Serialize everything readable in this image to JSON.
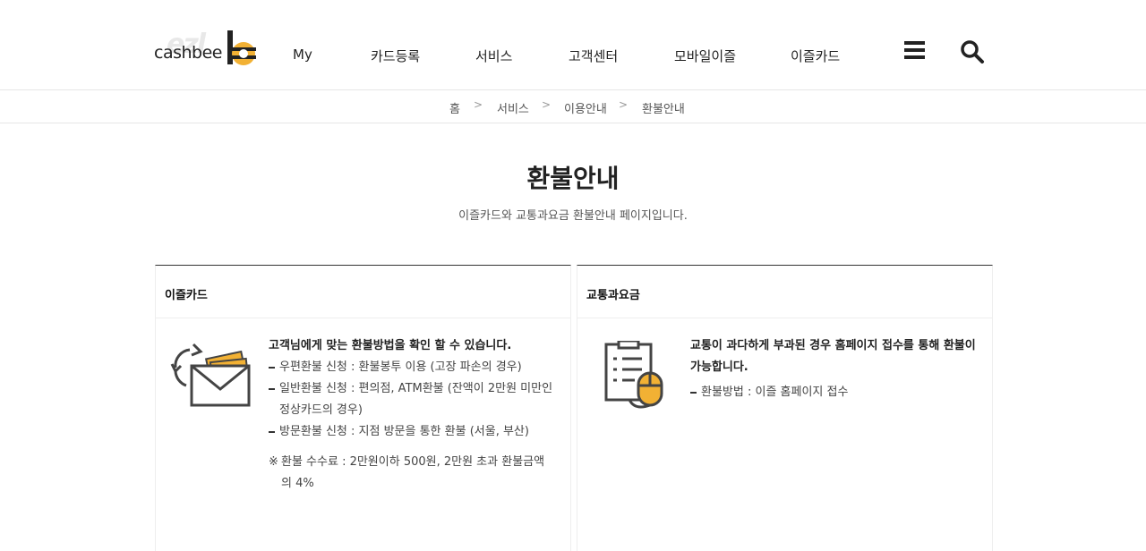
{
  "brand": {
    "logo_text": "cashbee",
    "colors": {
      "accent": "#f2b134",
      "dark": "#333333"
    }
  },
  "nav": {
    "items": [
      "My",
      "카드등록",
      "서비스",
      "고객센터",
      "모바일이즐",
      "이즐카드"
    ],
    "menu_icon": "hamburger-icon",
    "search_icon": "search-icon"
  },
  "breadcrumb": {
    "items": [
      "홈",
      "서비스",
      "이용안내",
      "환불안내"
    ],
    "separator": ">"
  },
  "page": {
    "title": "환불안내",
    "subtitle": "이즐카드와 교통과요금 환불안내 페이지입니다."
  },
  "panels": {
    "card": {
      "heading": "이즐카드",
      "lead": "고객님에게 맞는 환불방법을 확인 할 수 있습니다.",
      "items": [
        "우편환불 신청 : 환불봉투 이용 (고장 파손의 경우)",
        "일반환불 신청 : 편의점, ATM환불 (잔액이 2만원 미만인 정상카드의 경우)",
        "방문환불 신청 : 지점 방문을 통한 환불 (서울, 부산)"
      ],
      "note_mark": "※",
      "note": "환불 수수료 : 2만원이하 500원, 2만원 초과 환불금액의 4%"
    },
    "transit": {
      "heading": "교통과요금",
      "lead": "교통이 과다하게 부과된 경우 홈페이지 접수를 통해 환불이 가능합니다.",
      "items": [
        "환불방법 : 이즐 홈페이지 접수"
      ]
    }
  }
}
